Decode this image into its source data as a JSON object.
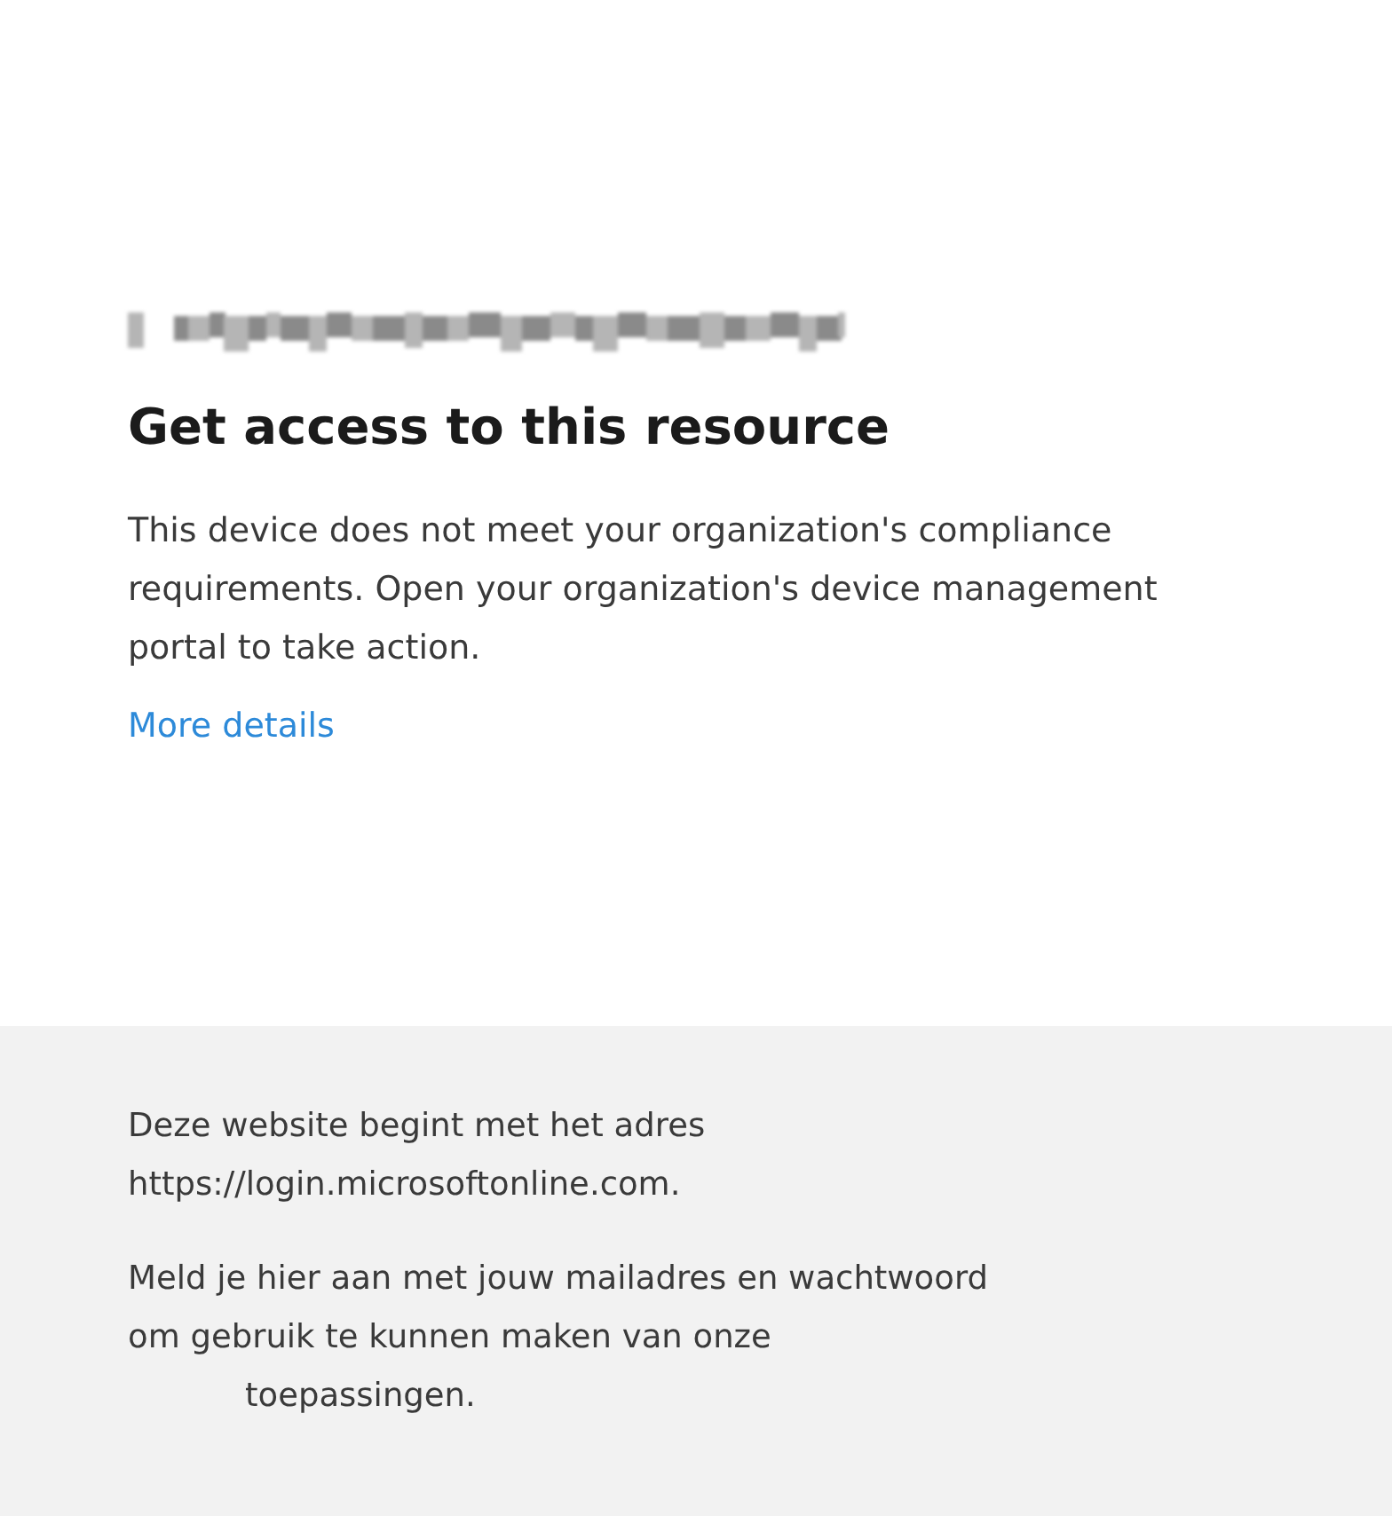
{
  "account": {
    "redacted": true
  },
  "heading": "Get access to this resource",
  "description": "This device does not meet your organization's compliance requirements. Open your organization's device management portal to take action.",
  "details_link": "More details",
  "footer": {
    "paragraphs": [
      {
        "lines": [
          "Deze website begint met het adres",
          "https://login.microsoftonline.com."
        ]
      },
      {
        "lines": [
          "Meld je hier aan met jouw mailadres en wachtwoord",
          "om gebruik te kunnen maken van onze",
          "toepassingen."
        ]
      }
    ]
  }
}
